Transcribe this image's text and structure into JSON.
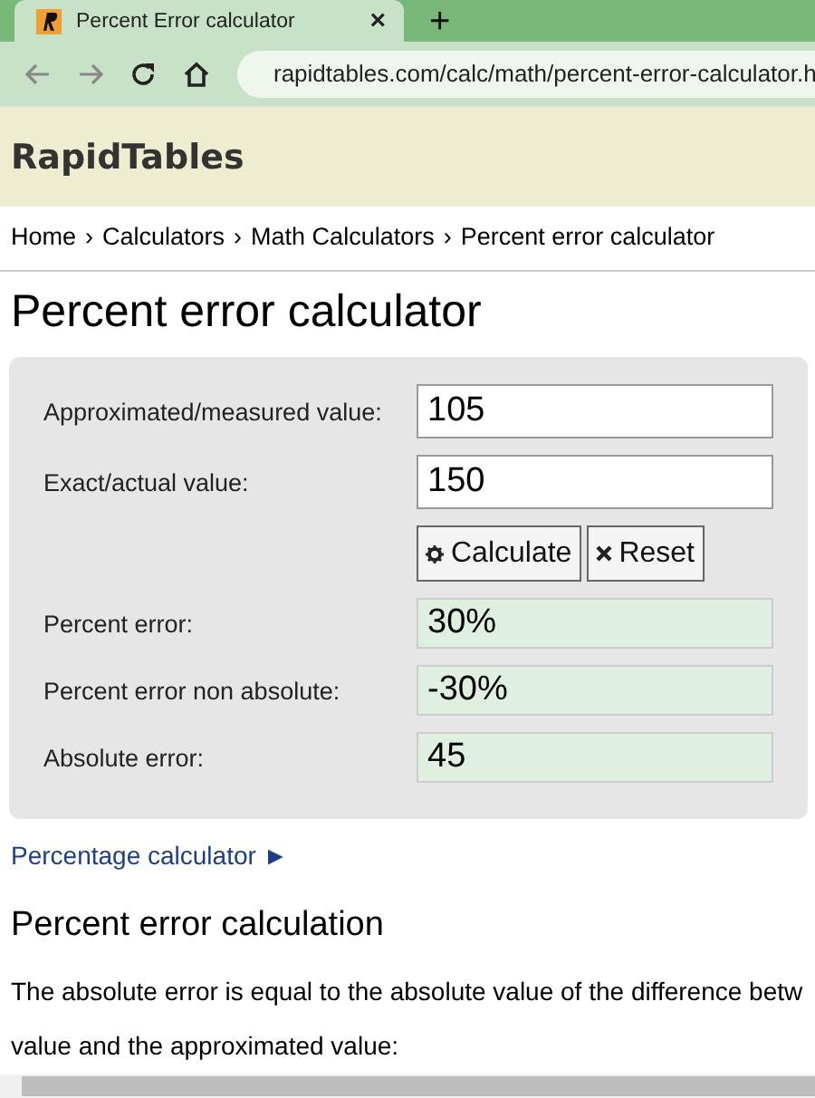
{
  "browser": {
    "tab_title": "Percent Error calculator",
    "tab_close": "×",
    "new_tab": "+",
    "url": "rapidtables.com/calc/math/percent-error-calculator.h"
  },
  "site": {
    "logo": "RapidTables"
  },
  "breadcrumb": [
    {
      "label": "Home"
    },
    {
      "separator": "›",
      "label": "Calculators"
    },
    {
      "separator": "›",
      "label": "Math Calculators"
    },
    {
      "separator": "›",
      "label": "Percent error calculator"
    }
  ],
  "title": "Percent error calculator",
  "inputs": [
    {
      "label": "Approximated/measured value:",
      "value": "105"
    },
    {
      "label": "Exact/actual value:",
      "value": "150"
    }
  ],
  "buttons": [
    {
      "kind": "calculate",
      "label": "Calculate"
    },
    {
      "kind": "reset",
      "label": "Reset"
    }
  ],
  "results": [
    {
      "label": "Percent error:",
      "value": "30%"
    },
    {
      "label": "Percent error non absolute:",
      "value": "-30%"
    },
    {
      "label": "Absolute error:",
      "value": "45"
    }
  ],
  "link": {
    "label": "Percentage calculator ►"
  },
  "section_title": "Percent error calculation",
  "paragraph_lines": [
    "The absolute error is equal to the absolute value of the difference betw",
    "value and the approximated value:"
  ]
}
